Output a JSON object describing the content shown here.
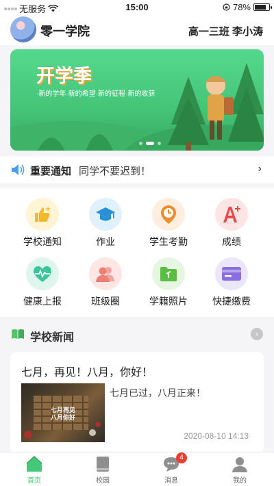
{
  "status_bar": {
    "carrier": "无服务",
    "time": "15:00",
    "battery": "78%",
    "battery_level": 0.78
  },
  "header": {
    "school_name": "零一学院",
    "class_info": "高一三班 李小涛"
  },
  "banner": {
    "title": "开学季",
    "subtitle": "·新的学年·新的希望·新的征程·新的收获",
    "slide_count": 3,
    "active_slide": 1
  },
  "notice": {
    "label": "重要通知",
    "text": "同学不要迟到！",
    "icon": "speaker-icon"
  },
  "grid": {
    "items": [
      {
        "label": "学校通知",
        "icon": "thumbs-up-icon",
        "bg": "#fff4d6",
        "color": "#f4b928"
      },
      {
        "label": "作业",
        "icon": "graduation-cap-icon",
        "bg": "#e1f1fb",
        "color": "#2a8fd6"
      },
      {
        "label": "学生考勤",
        "icon": "clock-pin-icon",
        "bg": "#fdeee0",
        "color": "#f08a2a"
      },
      {
        "label": "成绩",
        "icon": "a-plus-icon",
        "bg": "#fde5e5",
        "color": "#e84a4a"
      },
      {
        "label": "健康上报",
        "icon": "heart-pulse-icon",
        "bg": "#dff6ee",
        "color": "#3cc49a"
      },
      {
        "label": "班级圈",
        "icon": "people-icon",
        "bg": "#fde6e4",
        "color": "#ee7f77"
      },
      {
        "label": "学籍照片",
        "icon": "folder-icon",
        "bg": "#e6f6e2",
        "color": "#5cbd44"
      },
      {
        "label": "快捷缴费",
        "icon": "card-icon",
        "bg": "#ece6fa",
        "color": "#8b6ee0"
      }
    ]
  },
  "news": {
    "section_title": "学校新闻",
    "item": {
      "title": "七月，再见！八月，你好！",
      "thumb_text_1": "七月再见",
      "thumb_text_2": "八月你好",
      "summary": "七月已过，八月正来！",
      "date": "2020-08-10 14:13"
    }
  },
  "tabbar": {
    "tabs": [
      {
        "label": "首页",
        "icon": "home-icon",
        "active": true
      },
      {
        "label": "校园",
        "icon": "book-icon",
        "active": false
      },
      {
        "label": "消息",
        "icon": "chat-icon",
        "active": false,
        "badge": "4"
      },
      {
        "label": "我的",
        "icon": "user-icon",
        "active": false
      }
    ]
  },
  "colors": {
    "accent": "#3ec872",
    "banner_green": "#4dd083",
    "badge_red": "#ef3b2d"
  }
}
